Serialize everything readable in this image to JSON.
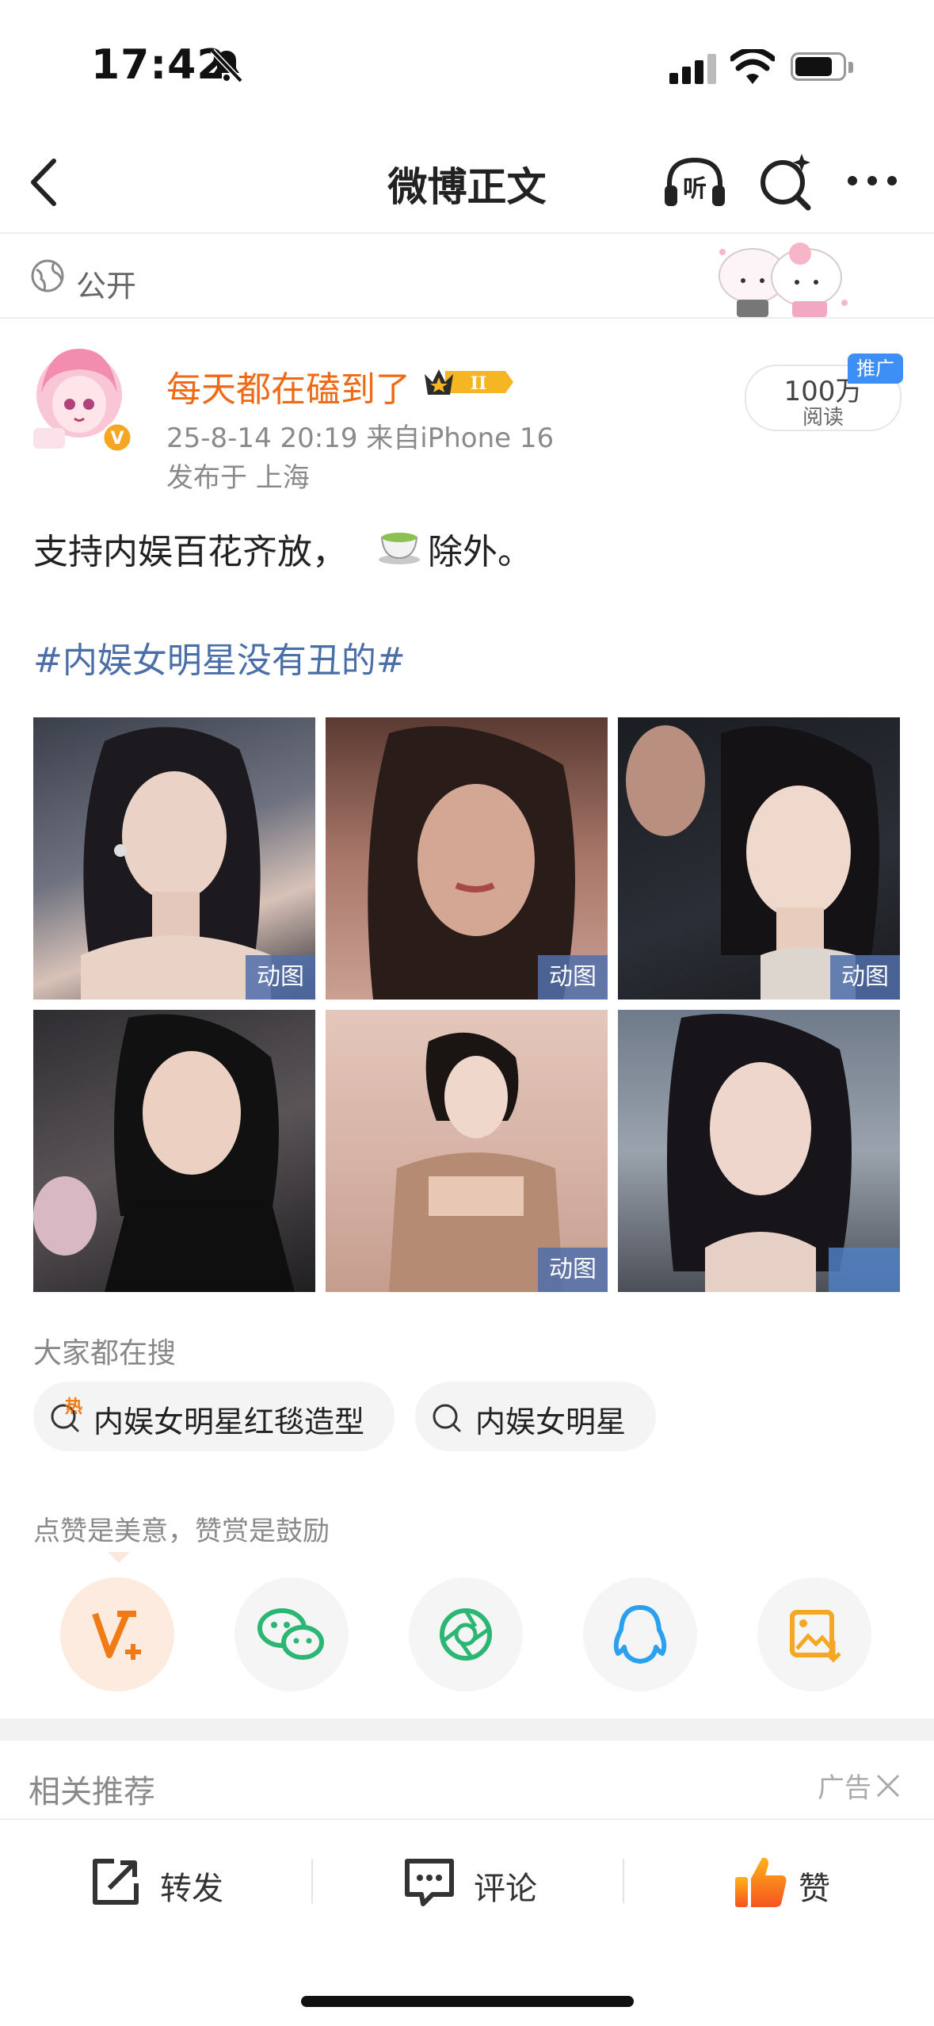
{
  "status_bar": {
    "time": "17:42"
  },
  "nav": {
    "title": "微博正文"
  },
  "visibility": {
    "label": "公开"
  },
  "post": {
    "author": "每天都在磕到了",
    "meta": "25-8-14 20:19 来自iPhone 16",
    "location": "发布于 上海",
    "reads_count": "100万",
    "reads_label": "阅读",
    "promo_tag": "推广",
    "text_before_emoji": "支持内娱百花齐放，",
    "text_after_emoji": "除外。",
    "topic": "#内娱女明星没有丑的#",
    "gif_label": "动图",
    "photos": [
      {
        "gif": true
      },
      {
        "gif": true
      },
      {
        "gif": true
      },
      {
        "gif": false
      },
      {
        "gif": true
      },
      {
        "gif": false
      }
    ]
  },
  "searches": {
    "heading": "大家都在搜",
    "hot_badge": "热",
    "items": [
      "内娱女明星红毯造型",
      "内娱女明星"
    ]
  },
  "reward": {
    "tip": "点赞是美意，赞赏是鼓励"
  },
  "share_icons": [
    "reward-v-icon",
    "wechat-icon",
    "moments-icon",
    "qq-icon",
    "save-image-icon"
  ],
  "related": {
    "title": "相关推荐",
    "ad_label": "广告"
  },
  "actions": {
    "repost": "转发",
    "comment": "评论",
    "like": "赞"
  },
  "colors": {
    "accent_orange": "#f06a15",
    "topic_blue": "#4a6ea8",
    "wechat_green": "#2bb673",
    "qq_blue": "#2aa0f0"
  }
}
